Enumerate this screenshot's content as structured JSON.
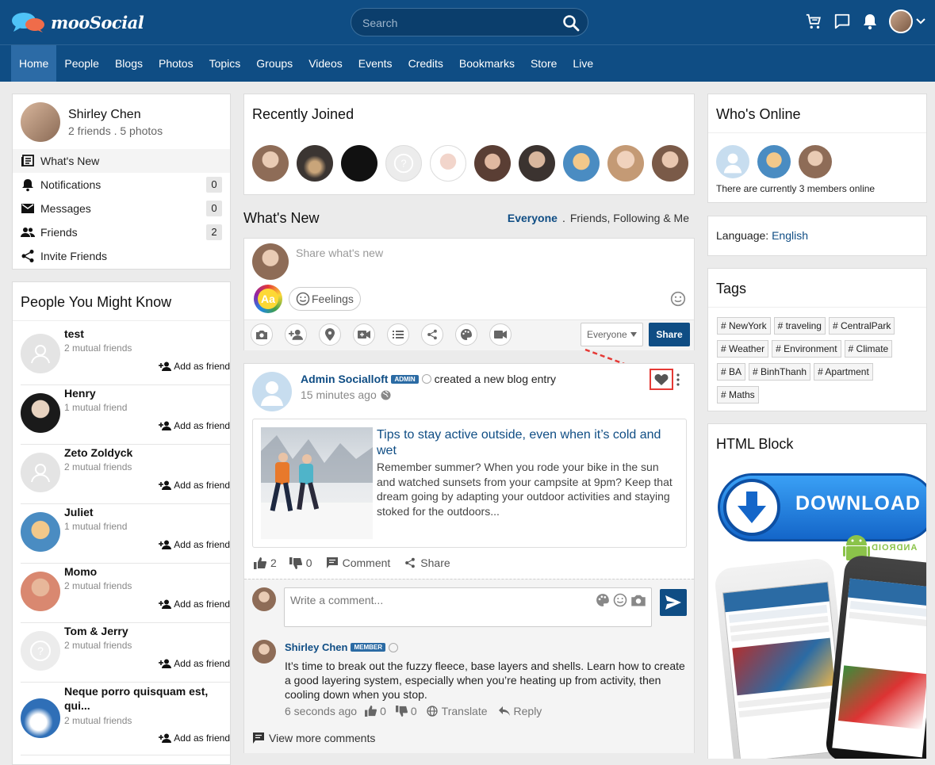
{
  "app": {
    "name": "mooSocial"
  },
  "search": {
    "placeholder": "Search"
  },
  "nav": [
    "Home",
    "People",
    "Blogs",
    "Photos",
    "Topics",
    "Groups",
    "Videos",
    "Events",
    "Credits",
    "Bookmarks",
    "Store",
    "Live"
  ],
  "profile": {
    "name": "Shirley Chen",
    "stats": "2 friends . 5 photos"
  },
  "sidebar_menu": [
    {
      "label": "What's New",
      "count": ""
    },
    {
      "label": "Notifications",
      "count": "0"
    },
    {
      "label": "Messages",
      "count": "0"
    },
    {
      "label": "Friends",
      "count": "2"
    },
    {
      "label": "Invite Friends",
      "count": ""
    }
  ],
  "people_you_might_know": {
    "title": "People You Might Know",
    "add_label": "Add as friend",
    "people": [
      {
        "name": "test",
        "mutual": "2 mutual friends"
      },
      {
        "name": "Henry",
        "mutual": "1 mutual friend"
      },
      {
        "name": "Zeto Zoldyck",
        "mutual": "2 mutual friends"
      },
      {
        "name": "Juliet",
        "mutual": "1 mutual friend"
      },
      {
        "name": "Momo",
        "mutual": "2 mutual friends"
      },
      {
        "name": "Tom & Jerry",
        "mutual": "2 mutual friends"
      },
      {
        "name": "Neque porro quisquam est, qui...",
        "mutual": "2 mutual friends"
      }
    ]
  },
  "recently_joined": {
    "title": "Recently Joined"
  },
  "whats_new": {
    "title": "What's New",
    "filter_everyone": "Everyone",
    "filter_sep": ".",
    "filter_friends": "Friends, Following & Me"
  },
  "composer": {
    "placeholder": "Share what's new",
    "aa": "Aa",
    "feelings": "Feelings",
    "privacy": "Everyone",
    "share": "Share"
  },
  "post": {
    "author": "Admin Socialloft",
    "badge": "ADMIN",
    "action": "created a new blog entry",
    "time": "15 minutes ago",
    "blog_title": "Tips to stay active outside, even when it’s cold and wet",
    "blog_excerpt": "Remember summer? When you rode your bike in the sun and watched sunsets from your campsite at 9pm? Keep that dream going by adapting your outdoor activities and staying stoked for the outdoors...",
    "likes": "2",
    "dislikes": "0",
    "comment_label": "Comment",
    "share_label": "Share"
  },
  "comment_box": {
    "placeholder": "Write a comment..."
  },
  "comment": {
    "author": "Shirley Chen",
    "badge": "MEMBER",
    "text": "It’s time to break out the fuzzy fleece, base layers and shells. Learn how to create a good layering system, especially when you’re heating up from activity, then cooling down when you stop.",
    "time": "6 seconds ago",
    "likes": "0",
    "dislikes": "0",
    "translate": "Translate",
    "reply": "Reply"
  },
  "view_more": "View more comments",
  "whos_online": {
    "title": "Who's Online",
    "text": "There are currently 3 members online"
  },
  "language": {
    "label": "Language:",
    "value": "English"
  },
  "tags": {
    "title": "Tags",
    "items": [
      "# NewYork",
      "# traveling",
      "# CentralPark",
      "# Weather",
      "# Environment",
      "# Climate",
      "# BA",
      "# BinhThanh",
      "# Apartment",
      "# Maths"
    ]
  },
  "html_block": {
    "title": "HTML Block",
    "download": "DOWNLOAD",
    "android": "ANDROID"
  },
  "colors": {
    "brand": "#0f4d84",
    "accent_red": "#e53935"
  }
}
